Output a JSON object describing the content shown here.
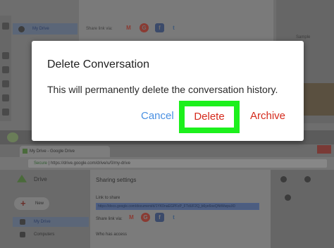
{
  "dialog": {
    "title": "Delete Conversation",
    "message": "This will permanently delete the conversation history.",
    "cancel_label": "Cancel",
    "delete_label": "Delete",
    "archive_label": "Archive"
  },
  "background": {
    "top": {
      "nav_active": "My Drive",
      "share_via_label": "Share link via:",
      "sample_label": "Sample",
      "share_icons": [
        "gmail-icon",
        "google-plus-icon",
        "facebook-icon",
        "twitter-icon"
      ]
    },
    "browser": {
      "tab_title": "My Drive - Google Drive",
      "secure_label": "Secure",
      "url": "https://drive.google.com/drive/u/0/my-drive"
    },
    "drive": {
      "app_name": "Drive",
      "new_label": "New",
      "nav": [
        "My Drive",
        "Computers"
      ],
      "sharing_title": "Sharing settings",
      "link_label": "Link to share",
      "share_link": "https://docs.google.com/document/d/1YK0naEGPFzP_FTdUF2Q_b6ye6oeQNtWwpuX0",
      "share_via_label": "Share link via:",
      "who_has_access": "Who has access"
    }
  },
  "colors": {
    "link_blue": "#4a90e2",
    "delete_red": "#d42a1c",
    "highlight_green": "#1cf01c"
  }
}
